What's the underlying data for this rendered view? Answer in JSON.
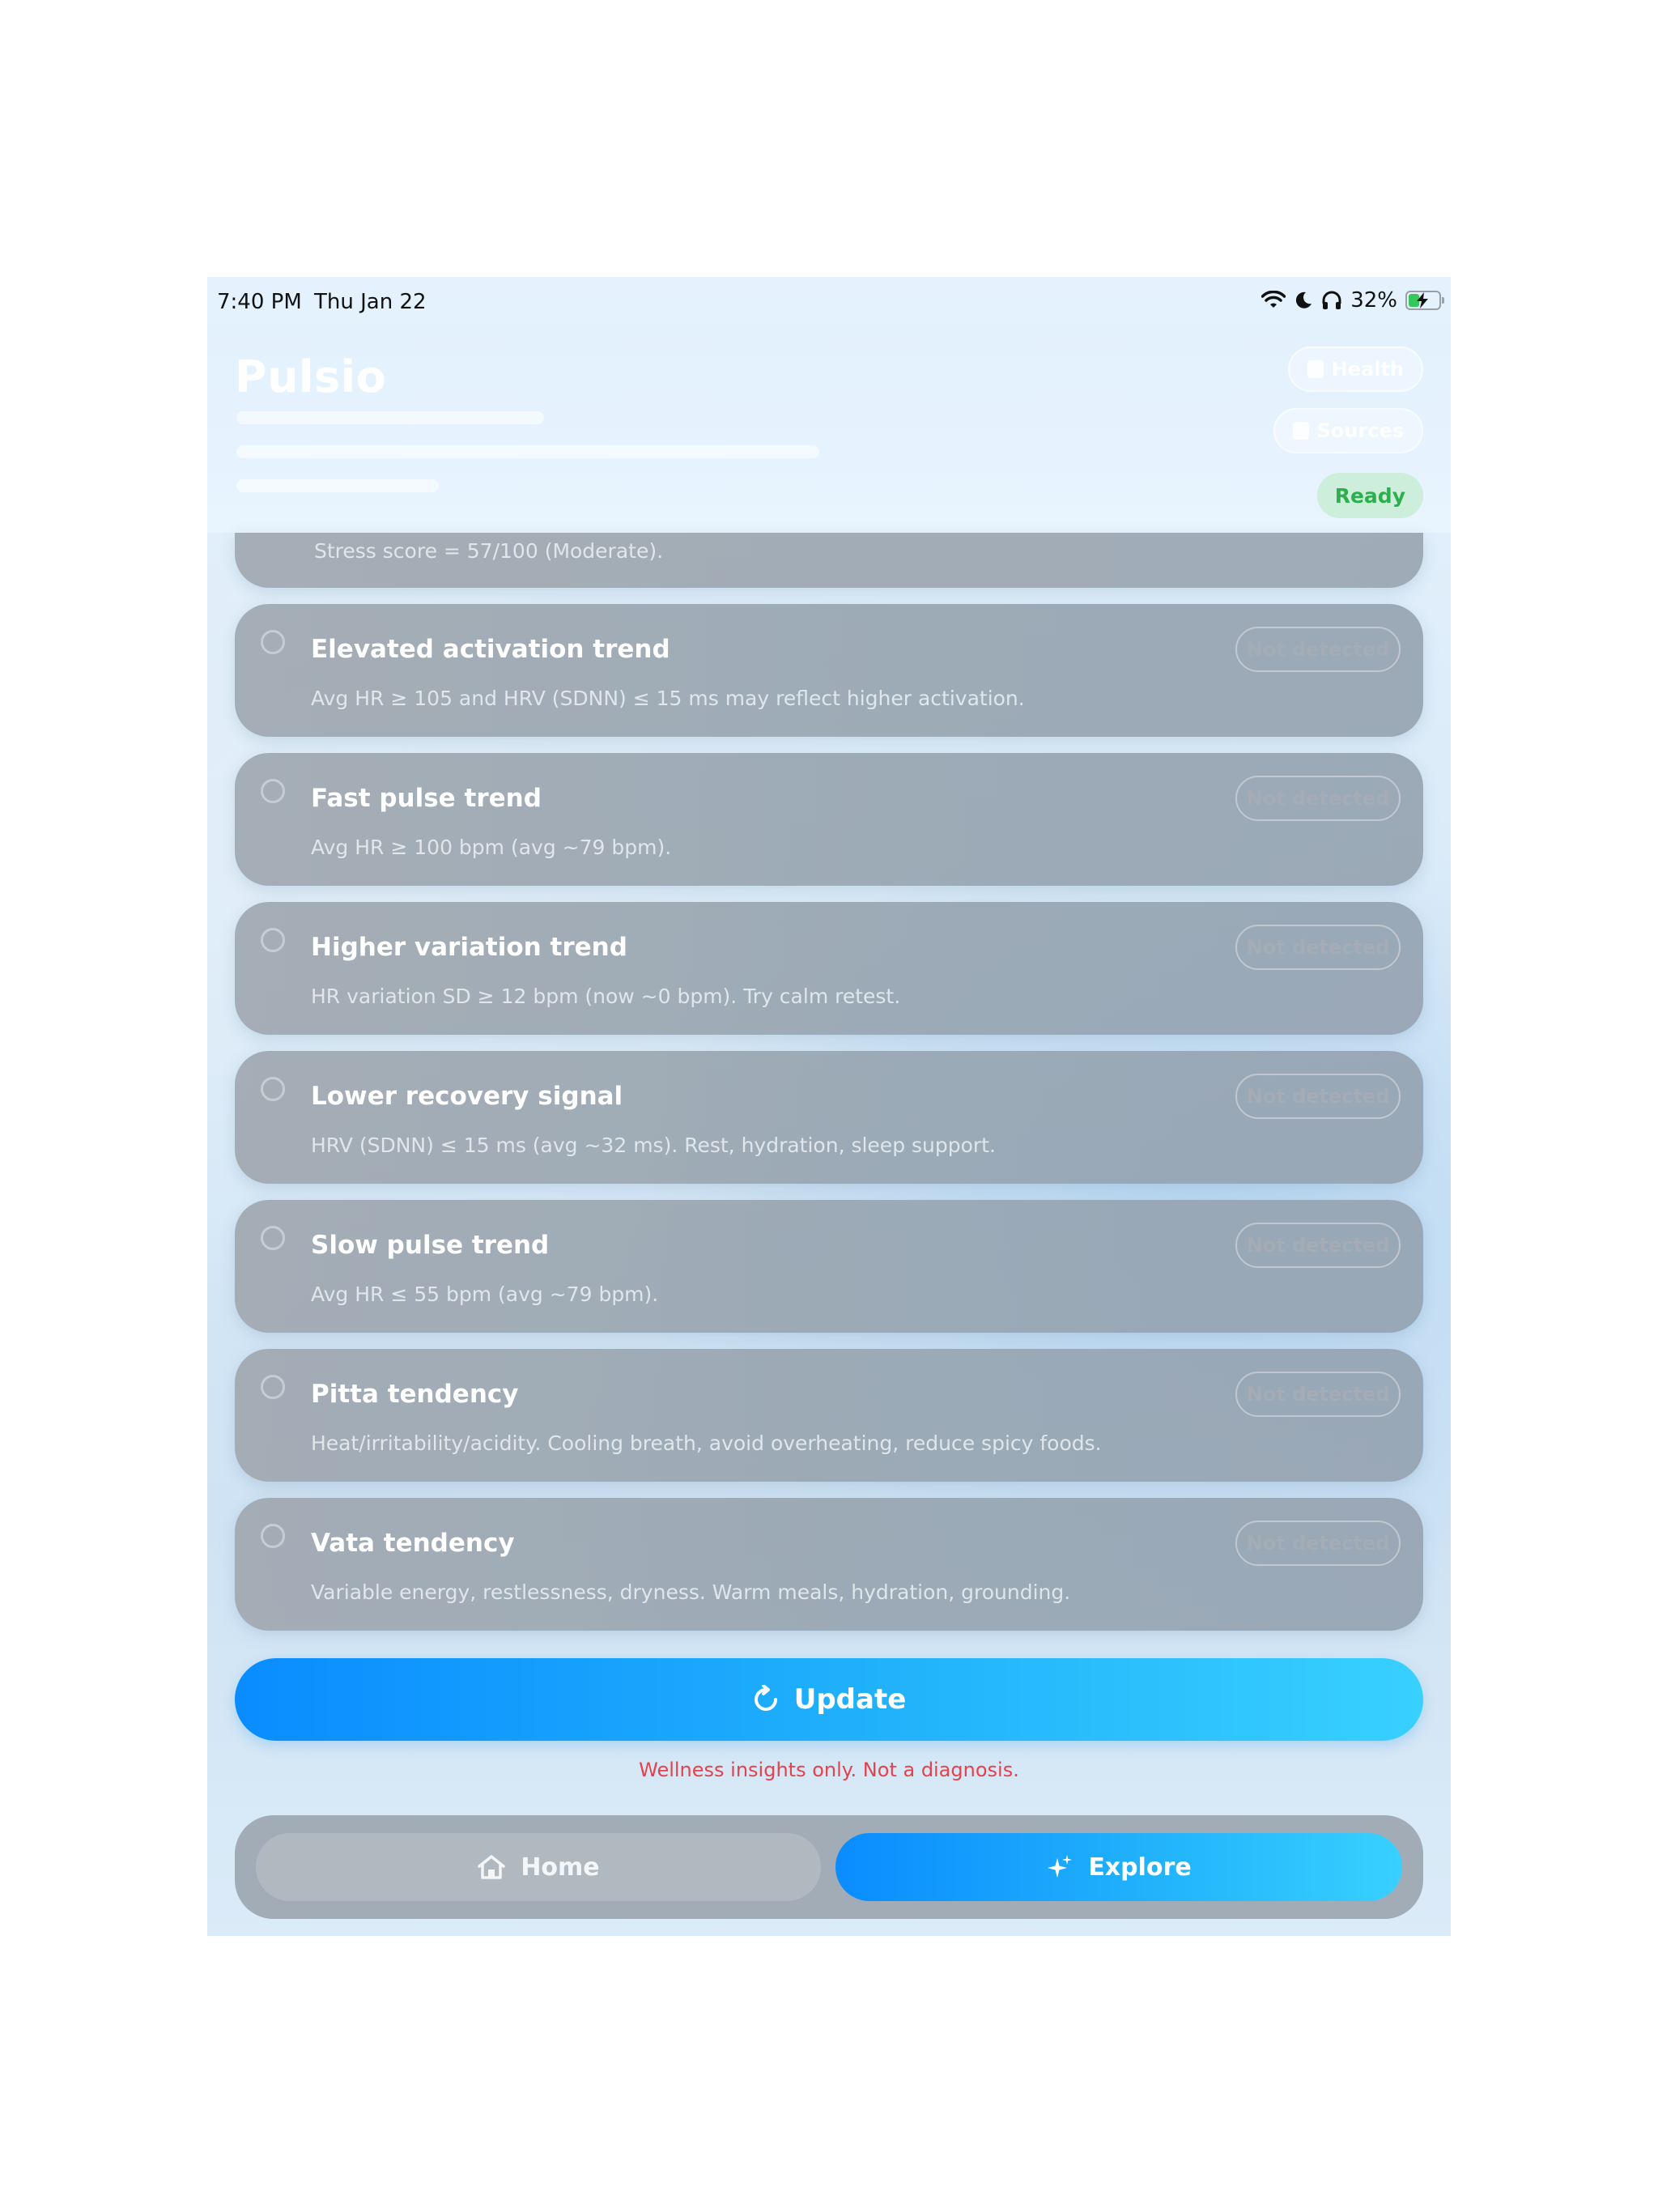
{
  "status_bar": {
    "time": "7:40 PM",
    "date": "Thu Jan 22",
    "battery": "32%",
    "icons": [
      "wifi-icon",
      "moon-icon",
      "headphones-icon",
      "battery-icon"
    ]
  },
  "header": {
    "app_title": "Pulsio",
    "buttons": [
      {
        "label": "Health",
        "icon": "health-icon"
      },
      {
        "label": "Sources",
        "icon": "book-icon"
      }
    ],
    "status_label": "Ready"
  },
  "partial_card": {
    "description": "Stress score = 57/100 (Moderate)."
  },
  "insights": [
    {
      "title": "Elevated activation trend",
      "description": "Avg HR ≥ 105 and HRV (SDNN) ≤ 15 ms may reflect higher activation.",
      "status": "Not detected"
    },
    {
      "title": "Fast pulse trend",
      "description": "Avg HR ≥ 100 bpm (avg ~79 bpm).",
      "status": "Not detected"
    },
    {
      "title": "Higher variation trend",
      "description": "HR variation SD ≥ 12 bpm (now ~0 bpm). Try calm retest.",
      "status": "Not detected"
    },
    {
      "title": "Lower recovery signal",
      "description": "HRV (SDNN) ≤ 15 ms (avg ~32 ms). Rest, hydration, sleep support.",
      "status": "Not detected"
    },
    {
      "title": "Slow pulse trend",
      "description": "Avg HR ≤ 55 bpm (avg ~79 bpm).",
      "status": "Not detected"
    },
    {
      "title": "Pitta tendency",
      "description": "Heat/irritability/acidity. Cooling breath, avoid overheating, reduce spicy foods.",
      "status": "Not detected"
    },
    {
      "title": "Vata tendency",
      "description": "Variable energy, restlessness, dryness. Warm meals, hydration, grounding.",
      "status": "Not detected"
    }
  ],
  "update_button": {
    "label": "Update",
    "icon": "refresh-icon"
  },
  "disclaimer": "Wellness insights only. Not a diagnosis.",
  "tabs": {
    "home": {
      "label": "Home",
      "icon": "home-icon"
    },
    "explore": {
      "label": "Explore",
      "icon": "sparkles-icon"
    }
  },
  "colors": {
    "accent": "#0a8cff",
    "accent_end": "#38d0ff",
    "ready": "#2bb04d",
    "disclaimer": "#e4424d"
  }
}
